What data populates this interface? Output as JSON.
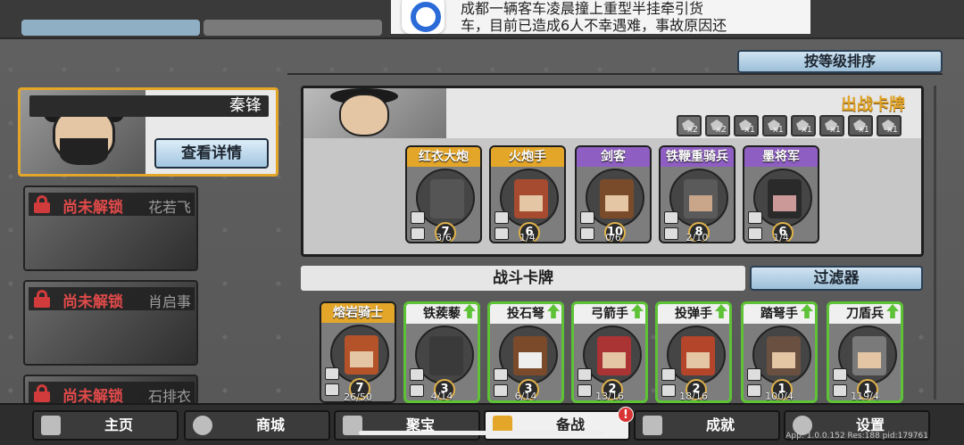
{
  "notification": {
    "line1": "成都一辆客车凌晨撞上重型半挂牵引货",
    "line2": "车，目前已造成6人不幸遇难，事故原因还"
  },
  "sort_button": "按等级排序",
  "heroes": [
    {
      "name": "秦锋",
      "detail_label": "查看详情",
      "locked": false
    },
    {
      "name": "花若飞",
      "lock_label": "尚未解锁",
      "locked": true
    },
    {
      "name": "肖启事",
      "lock_label": "尚未解锁",
      "locked": true
    },
    {
      "name": "石排衣",
      "lock_label": "尚未解锁",
      "locked": true
    }
  ],
  "deploy": {
    "title": "出战卡牌",
    "slots": [
      "x2",
      "x2",
      "x1",
      "x1",
      "x1",
      "x1",
      "x1",
      "x1"
    ],
    "cards": [
      {
        "name": "红衣大炮",
        "level": "7",
        "count": "3/6",
        "rarity": "gold"
      },
      {
        "name": "火炮手",
        "level": "6",
        "count": "1/4",
        "rarity": "gold"
      },
      {
        "name": "剑客",
        "level": "10",
        "count": "0/6",
        "rarity": "purple"
      },
      {
        "name": "铁鞭重骑兵",
        "level": "8",
        "count": "2/10",
        "rarity": "purple"
      },
      {
        "name": "墨将军",
        "level": "6",
        "count": "1/4",
        "rarity": "purple"
      }
    ]
  },
  "battle_section": "战斗卡牌",
  "filter_button": "过滤器",
  "battle_cards": [
    {
      "name": "熔岩骑士",
      "level": "7",
      "count": "26/50",
      "upgrade": false
    },
    {
      "name": "铁蒺藜",
      "level": "3",
      "count": "4/14",
      "upgrade": true
    },
    {
      "name": "投石弩",
      "level": "3",
      "count": "6/14",
      "upgrade": true
    },
    {
      "name": "弓箭手",
      "level": "2",
      "count": "13/16",
      "upgrade": true
    },
    {
      "name": "投弹手",
      "level": "2",
      "count": "18/16",
      "upgrade": true
    },
    {
      "name": "踏弩手",
      "level": "1",
      "count": "100/4",
      "upgrade": true
    },
    {
      "name": "刀盾兵",
      "level": "1",
      "count": "119/4",
      "upgrade": true
    }
  ],
  "nav": {
    "home": "主页",
    "shop": "商城",
    "treasure": "聚宝",
    "battle": "备战",
    "achievements": "成就",
    "settings": "设置",
    "battle_badge": "!"
  },
  "version": "App: 1.0.0.152 Res:188 pid:179761"
}
